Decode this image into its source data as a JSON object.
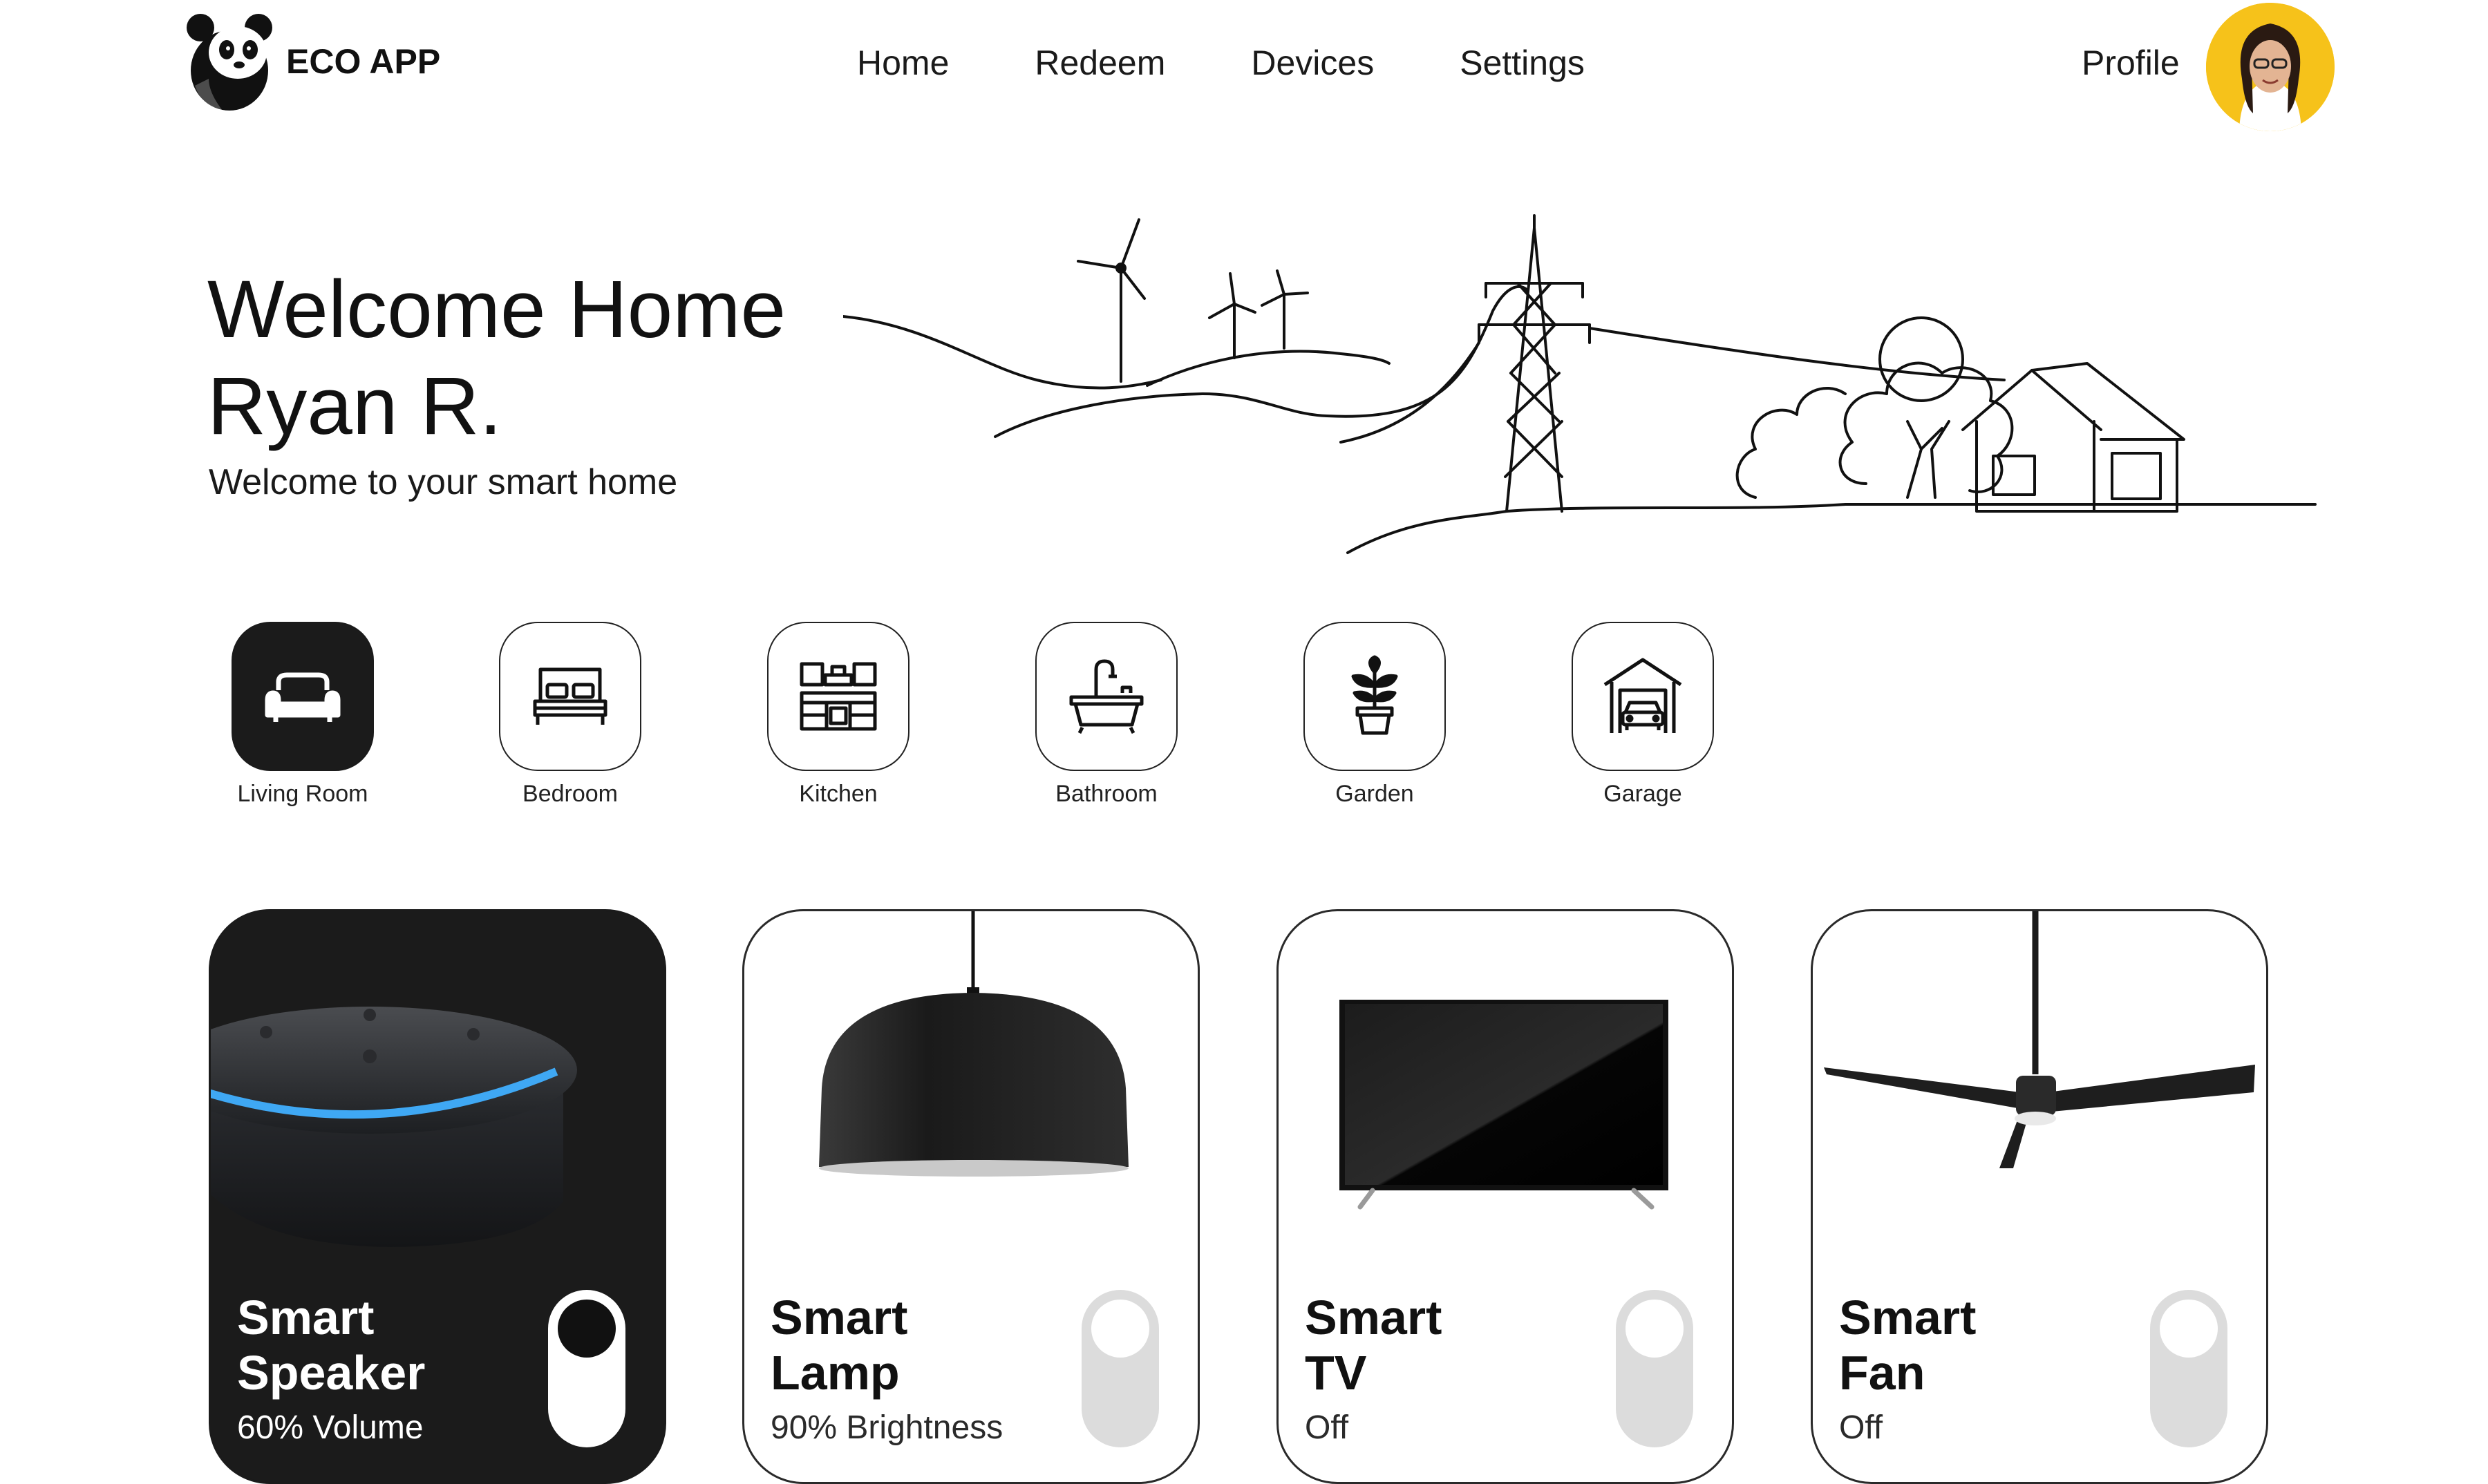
{
  "app": {
    "name": "ECO APP"
  },
  "nav": {
    "items": [
      "Home",
      "Redeem",
      "Devices",
      "Settings"
    ],
    "profile_label": "Profile"
  },
  "welcome": {
    "line1": "Welcome Home",
    "line2": "Ryan R.",
    "subtitle": "Welcome to your smart home"
  },
  "rooms": [
    {
      "label": "Living Room",
      "icon": "sofa-icon",
      "active": true
    },
    {
      "label": "Bedroom",
      "icon": "bed-icon",
      "active": false
    },
    {
      "label": "Kitchen",
      "icon": "kitchen-icon",
      "active": false
    },
    {
      "label": "Bathroom",
      "icon": "bathtub-icon",
      "active": false
    },
    {
      "label": "Garden",
      "icon": "plant-icon",
      "active": false
    },
    {
      "label": "Garage",
      "icon": "garage-icon",
      "active": false
    }
  ],
  "devices": [
    {
      "name_line1": "Smart",
      "name_line2": "Speaker",
      "status": "60% Volume",
      "on": true
    },
    {
      "name_line1": "Smart",
      "name_line2": "Lamp",
      "status": "90% Brightness",
      "on": false
    },
    {
      "name_line1": "Smart",
      "name_line2": "TV",
      "status": "Off",
      "on": false
    },
    {
      "name_line1": "Smart",
      "name_line2": "Fan",
      "status": "Off",
      "on": false
    }
  ],
  "colors": {
    "dark": "#1b1b1b",
    "accent_yellow": "#f6c21a",
    "speaker_ring": "#3fa8f4",
    "toggle_off": "#dcdcdc"
  }
}
